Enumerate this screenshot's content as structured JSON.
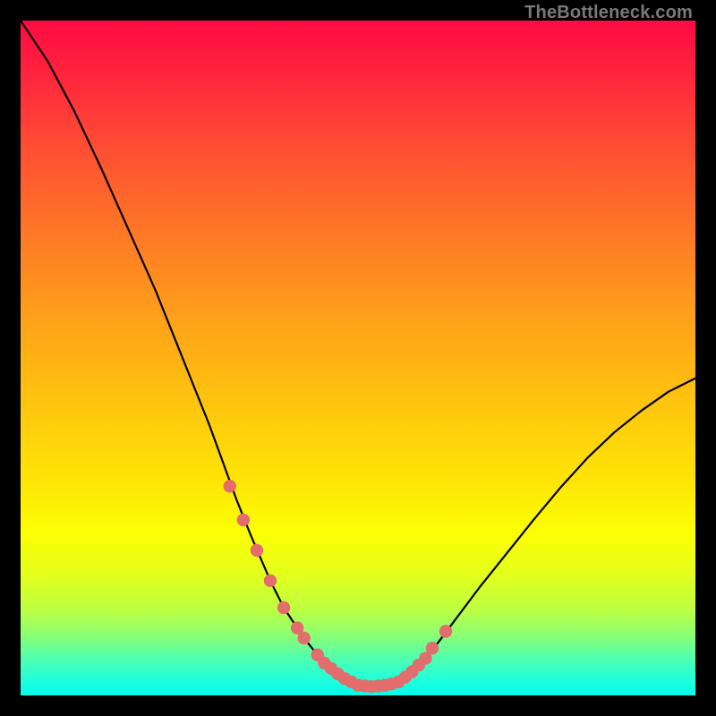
{
  "watermark": "TheBottleneck.com",
  "chart_data": {
    "type": "line",
    "title": "",
    "xlabel": "",
    "ylabel": "",
    "xlim": [
      0,
      100
    ],
    "ylim": [
      0,
      100
    ],
    "grid": false,
    "legend": false,
    "series": [
      {
        "name": "curve",
        "color": "#000000",
        "x": [
          0,
          4,
          8,
          12,
          16,
          20,
          24,
          28,
          32,
          34,
          37,
          39,
          41,
          42,
          44,
          45,
          46,
          48,
          50,
          52,
          54,
          56,
          58,
          60,
          62,
          65,
          68,
          72,
          76,
          80,
          84,
          88,
          92,
          96,
          100
        ],
        "values": [
          100,
          94,
          86.5,
          78,
          69,
          60,
          50,
          40,
          29,
          24,
          17,
          13,
          10,
          8.5,
          6,
          4.8,
          4,
          2.5,
          1.5,
          1.3,
          1.5,
          2,
          3.5,
          5.5,
          8,
          12,
          16,
          21,
          26,
          30.8,
          35.2,
          39,
          42.2,
          45,
          47
        ]
      },
      {
        "name": "highlighted-dots",
        "color": "#e36c6c",
        "mode": "markers",
        "x": [
          31,
          33,
          35,
          37,
          39,
          41,
          42,
          44,
          45,
          46,
          47,
          48,
          49,
          50,
          51,
          52,
          53,
          54,
          55,
          56,
          57,
          58,
          59,
          60,
          61,
          63
        ],
        "values": [
          31,
          26,
          21.5,
          17,
          13,
          10,
          8.5,
          6,
          4.8,
          4,
          3.2,
          2.5,
          2,
          1.5,
          1.4,
          1.3,
          1.4,
          1.5,
          1.7,
          2,
          2.7,
          3.5,
          4.5,
          5.5,
          7,
          9.5
        ]
      }
    ]
  }
}
